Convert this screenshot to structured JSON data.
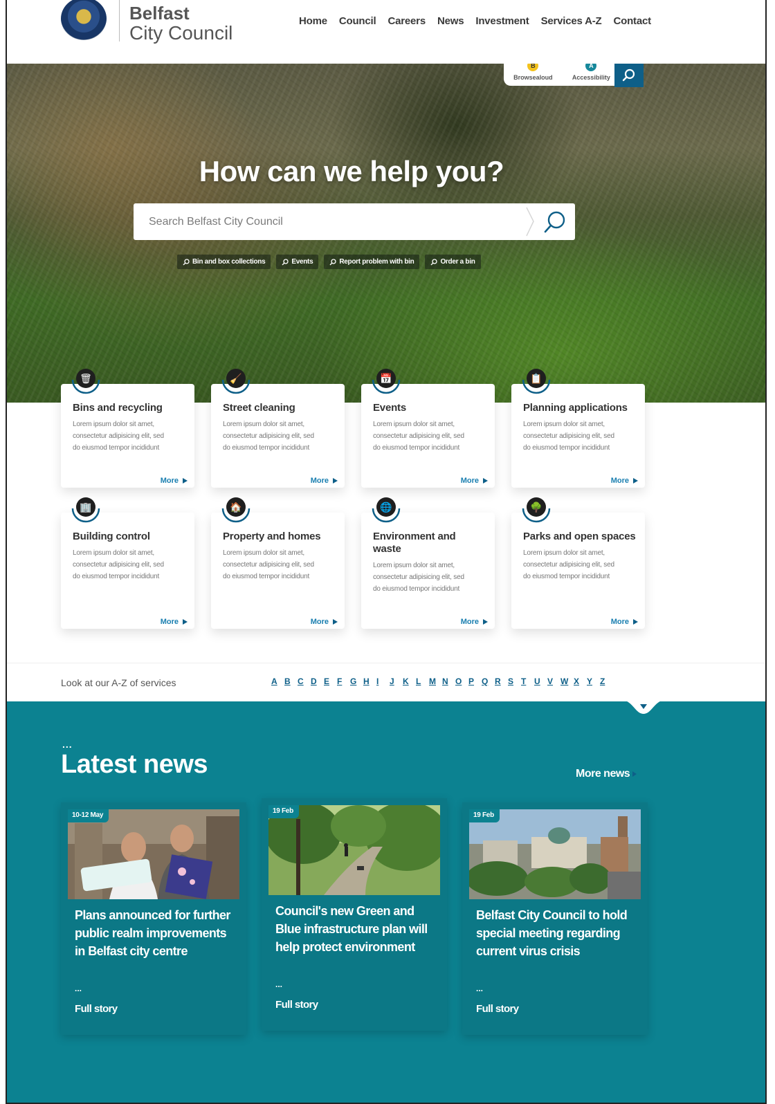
{
  "brand": {
    "line1": "Belfast",
    "line2": "City Council"
  },
  "nav": [
    "Home",
    "Council",
    "Careers",
    "News",
    "Investment",
    "Services A-Z",
    "Contact"
  ],
  "utility": {
    "browsealoud": {
      "badge": "B",
      "label": "Browsealoud"
    },
    "accessibility": {
      "badge": "A",
      "label": "Accessibility"
    }
  },
  "hero": {
    "title": "How can we help you?",
    "search_placeholder": "Search Belfast City Council",
    "quick_links": [
      "Bin and box collections",
      "Events",
      "Report problem with bin",
      "Order a bin"
    ]
  },
  "services": [
    {
      "title": "Bins and recycling",
      "icon": "bin-icon",
      "glyph": "🗑",
      "desc": [
        "Lorem ipsum dolor sit amet,",
        "consectetur adipisicing elit, sed",
        "do eiusmod tempor incididunt"
      ],
      "more": "More"
    },
    {
      "title": "Street cleaning",
      "icon": "broom-icon",
      "glyph": "🧹",
      "desc": [
        "Lorem ipsum dolor sit amet,",
        "consectetur adipisicing elit, sed",
        "do eiusmod tempor incididunt"
      ],
      "more": "More"
    },
    {
      "title": "Events",
      "icon": "calendar-icon",
      "glyph": "📅",
      "desc": [
        "Lorem ipsum dolor sit amet,",
        "consectetur adipisicing elit, sed",
        "do eiusmod tempor incididunt"
      ],
      "more": "More"
    },
    {
      "title": "Planning applications",
      "icon": "document-icon",
      "glyph": "📋",
      "desc": [
        "Lorem ipsum dolor sit amet,",
        "consectetur adipisicing elit, sed",
        "do eiusmod tempor incididunt"
      ],
      "more": "More"
    },
    {
      "title": "Building control",
      "icon": "building-icon",
      "glyph": "🏢",
      "desc": [
        "Lorem ipsum dolor sit amet,",
        "consectetur adipisicing elit, sed",
        "do eiusmod tempor incididunt"
      ],
      "more": "More"
    },
    {
      "title": "Property and homes",
      "icon": "home-icon",
      "glyph": "🏠",
      "desc": [
        "Lorem ipsum dolor sit amet,",
        "consectetur adipisicing elit, sed",
        "do eiusmod tempor incididunt"
      ],
      "more": "More"
    },
    {
      "title": "Environment and waste",
      "icon": "globe-icon",
      "glyph": "🌐",
      "desc": [
        "Lorem ipsum dolor sit amet,",
        "consectetur adipisicing elit, sed",
        "do eiusmod tempor incididunt"
      ],
      "more": "More"
    },
    {
      "title": "Parks and open spaces",
      "icon": "tree-icon",
      "glyph": "🌳",
      "desc": [
        "Lorem ipsum dolor sit amet,",
        "consectetur adipisicing elit, sed",
        "do eiusmod tempor incididunt"
      ],
      "more": "More"
    }
  ],
  "az": {
    "label": "Look at our A-Z of services",
    "letters": [
      "A",
      "B",
      "C",
      "D",
      "E",
      "F",
      "G",
      "H",
      "I",
      "J",
      "K",
      "L",
      "M",
      "N",
      "O",
      "P",
      "Q",
      "R",
      "S",
      "T",
      "U",
      "V",
      "W",
      "X",
      "Y",
      "Z"
    ]
  },
  "news": {
    "dots": "...",
    "title": "Latest news",
    "more": "More news",
    "items": [
      {
        "date": "10-12 May",
        "headline": "Plans announced for further public realm improvements in Belfast city centre",
        "dots": "...",
        "link": "Full story"
      },
      {
        "date": "19 Feb",
        "headline": "Council's new Green and Blue infrastructure plan will help protect environment",
        "dots": "...",
        "link": "Full story"
      },
      {
        "date": "19 Feb",
        "headline": "Belfast City Council to hold special meeting regarding current virus crisis",
        "dots": "...",
        "link": "Full story"
      }
    ]
  },
  "colors": {
    "teal": "#0c8291",
    "navy": "#0e5f88",
    "accent_yellow": "#f3c21d"
  }
}
